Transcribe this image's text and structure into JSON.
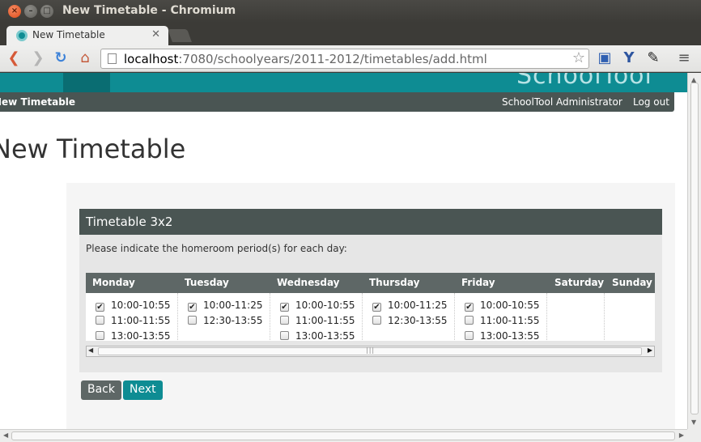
{
  "window": {
    "title": "New Timetable - Chromium"
  },
  "tab": {
    "title": "New Timetable"
  },
  "address": {
    "host": "localhost",
    "path": ":7080/schoolyears/2011-2012/timetables/add.html"
  },
  "header": {
    "logo": "SchoolTool"
  },
  "nav": {
    "title": "New Timetable",
    "user": "SchoolTool Administrator",
    "logout": "Log out"
  },
  "page": {
    "heading": "New Timetable"
  },
  "form": {
    "legend": "Timetable 3x2",
    "instructions": "Please indicate the homeroom period(s) for each day:",
    "days": [
      {
        "name": "Monday",
        "periods": [
          {
            "label": "10:00-10:55",
            "checked": true
          },
          {
            "label": "11:00-11:55",
            "checked": false
          },
          {
            "label": "13:00-13:55",
            "checked": false
          }
        ]
      },
      {
        "name": "Tuesday",
        "periods": [
          {
            "label": "10:00-11:25",
            "checked": true
          },
          {
            "label": "12:30-13:55",
            "checked": false
          }
        ]
      },
      {
        "name": "Wednesday",
        "periods": [
          {
            "label": "10:00-10:55",
            "checked": true
          },
          {
            "label": "11:00-11:55",
            "checked": false
          },
          {
            "label": "13:00-13:55",
            "checked": false
          }
        ]
      },
      {
        "name": "Thursday",
        "periods": [
          {
            "label": "10:00-11:25",
            "checked": true
          },
          {
            "label": "12:30-13:55",
            "checked": false
          }
        ]
      },
      {
        "name": "Friday",
        "periods": [
          {
            "label": "10:00-10:55",
            "checked": true
          },
          {
            "label": "11:00-11:55",
            "checked": false
          },
          {
            "label": "13:00-13:55",
            "checked": false
          }
        ]
      },
      {
        "name": "Saturday",
        "periods": []
      },
      {
        "name": "Sunday",
        "periods": []
      }
    ],
    "back_label": "Back",
    "next_label": "Next"
  },
  "colors": {
    "accent": "#0e8c93",
    "dark": "#4a5553"
  }
}
